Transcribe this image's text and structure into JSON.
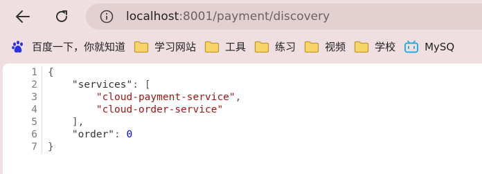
{
  "toolbar": {
    "url_host": "localhost",
    "url_rest": ":8001/payment/discovery"
  },
  "bookmarks": [
    {
      "label": "百度一下，你就知道",
      "icon": "baidu-icon"
    },
    {
      "label": "学习网站",
      "icon": "folder-icon"
    },
    {
      "label": "工具",
      "icon": "folder-icon"
    },
    {
      "label": "练习",
      "icon": "folder-icon"
    },
    {
      "label": "视频",
      "icon": "folder-icon"
    },
    {
      "label": "学校",
      "icon": "folder-icon"
    },
    {
      "label": "MySQ",
      "icon": "bilibili-icon"
    }
  ],
  "json_view": {
    "line_numbers": [
      "1",
      "2",
      "3",
      "4",
      "5",
      "6",
      "7"
    ],
    "open_brace": "{",
    "services_key": "\"services\"",
    "services_sep": ": [",
    "service_1": "\"cloud-payment-service\"",
    "service_1_comma": ",",
    "service_2": "\"cloud-order-service\"",
    "array_close": "],",
    "order_key": "\"order\"",
    "order_sep": ": ",
    "order_value": "0",
    "close_brace": "}"
  },
  "colors": {
    "chrome_bg": "#f0dfe0",
    "address_bg": "#e3d0d1",
    "folder_yellow": "#f2c14e"
  }
}
